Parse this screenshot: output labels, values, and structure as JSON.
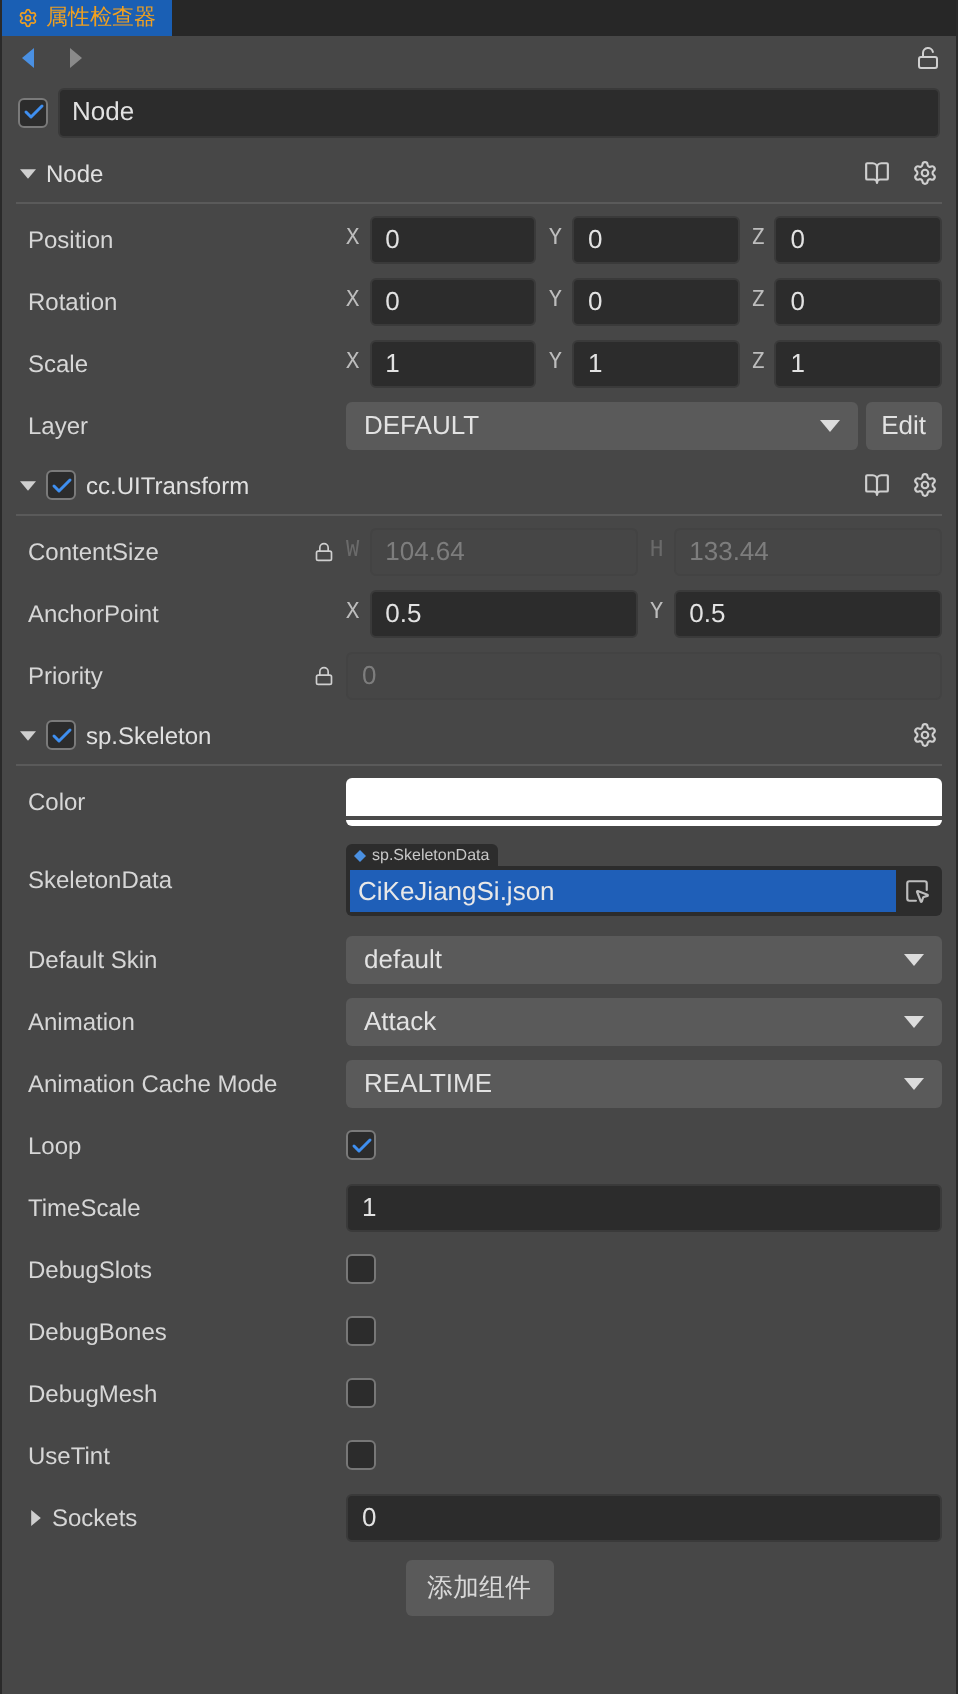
{
  "panel_tab": {
    "title": "属性检查器",
    "selected": true
  },
  "node": {
    "active": true,
    "name": "Node"
  },
  "components": [
    {
      "title": "Node",
      "expanded": true,
      "has_docs": true,
      "properties": [
        {
          "kind": "vec",
          "label": "Position",
          "locked": false,
          "axes": [
            {
              "axis": "X",
              "value": "0"
            },
            {
              "axis": "Y",
              "value": "0"
            },
            {
              "axis": "Z",
              "value": "0"
            }
          ]
        },
        {
          "kind": "vec",
          "label": "Rotation",
          "locked": false,
          "axes": [
            {
              "axis": "X",
              "value": "0"
            },
            {
              "axis": "Y",
              "value": "0"
            },
            {
              "axis": "Z",
              "value": "0"
            }
          ]
        },
        {
          "kind": "vec",
          "label": "Scale",
          "locked": false,
          "axes": [
            {
              "axis": "X",
              "value": "1"
            },
            {
              "axis": "Y",
              "value": "1"
            },
            {
              "axis": "Z",
              "value": "1"
            }
          ]
        },
        {
          "kind": "select",
          "label": "Layer",
          "value": "DEFAULT",
          "button": "Edit"
        }
      ]
    },
    {
      "title": "cc.UITransform",
      "enabled": true,
      "expanded": true,
      "has_docs": true,
      "properties": [
        {
          "kind": "vec",
          "label": "ContentSize",
          "locked": true,
          "axes": [
            {
              "axis": "W",
              "value": "104.64"
            },
            {
              "axis": "H",
              "value": "133.44"
            }
          ]
        },
        {
          "kind": "vec",
          "label": "AnchorPoint",
          "locked": false,
          "axes": [
            {
              "axis": "X",
              "value": "0.5"
            },
            {
              "axis": "Y",
              "value": "0.5"
            }
          ]
        },
        {
          "kind": "number",
          "label": "Priority",
          "locked": true,
          "value": "0"
        }
      ]
    },
    {
      "title": "sp.Skeleton",
      "enabled": true,
      "expanded": true,
      "has_docs": false,
      "properties": [
        {
          "kind": "color",
          "label": "Color",
          "color": "#ffffff"
        },
        {
          "kind": "asset",
          "label": "SkeletonData",
          "asset_type": "sp.SkeletonData",
          "value": "CiKeJiangSi.json"
        },
        {
          "kind": "select",
          "label": "Default Skin",
          "value": "default"
        },
        {
          "kind": "select",
          "label": "Animation",
          "value": "Attack"
        },
        {
          "kind": "select",
          "label": "Animation Cache Mode",
          "value": "REALTIME"
        },
        {
          "kind": "checkbox",
          "label": "Loop",
          "checked": true
        },
        {
          "kind": "number",
          "label": "TimeScale",
          "locked": false,
          "value": "1"
        },
        {
          "kind": "checkbox",
          "label": "DebugSlots",
          "checked": false
        },
        {
          "kind": "checkbox",
          "label": "DebugBones",
          "checked": false
        },
        {
          "kind": "checkbox",
          "label": "DebugMesh",
          "checked": false
        },
        {
          "kind": "checkbox",
          "label": "UseTint",
          "checked": false
        },
        {
          "kind": "number",
          "label": "Sockets",
          "locked": false,
          "expanded": false,
          "value": "0"
        }
      ]
    }
  ],
  "add_component_button": "添加组件"
}
